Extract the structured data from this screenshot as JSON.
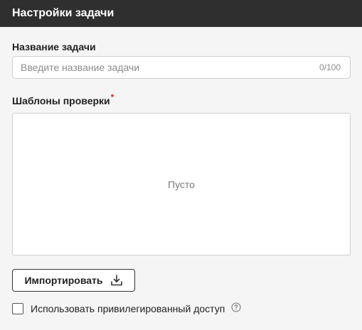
{
  "header": {
    "title": "Настройки задачи"
  },
  "task_name": {
    "label": "Название задачи",
    "placeholder": "Введите название задачи",
    "value": "",
    "counter": "0/100"
  },
  "templates": {
    "label": "Шаблоны проверки",
    "required_mark": "*",
    "empty_text": "Пусто"
  },
  "import_button": {
    "label": "Импортировать",
    "icon": "download-icon"
  },
  "privileged_access": {
    "label": "Использовать привилегированный доступ",
    "checked": false,
    "help_icon": "help-circle-icon"
  }
}
